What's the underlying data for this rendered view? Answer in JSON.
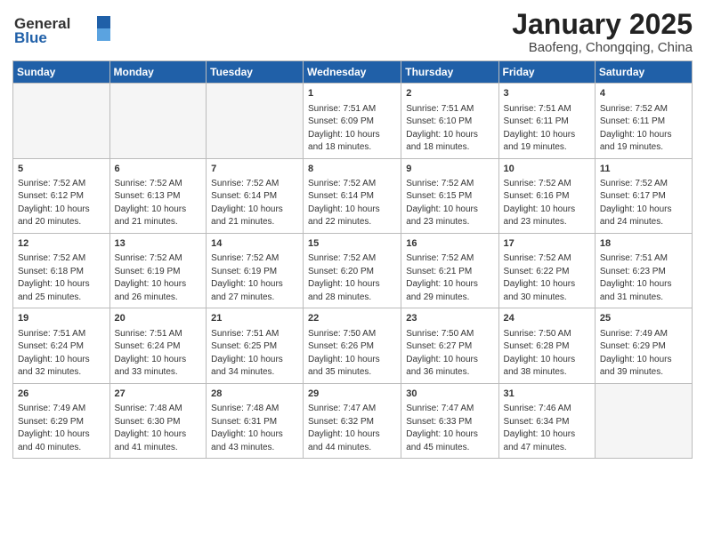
{
  "logo": {
    "general": "General",
    "blue": "Blue"
  },
  "header": {
    "month": "January 2025",
    "location": "Baofeng, Chongqing, China"
  },
  "weekdays": [
    "Sunday",
    "Monday",
    "Tuesday",
    "Wednesday",
    "Thursday",
    "Friday",
    "Saturday"
  ],
  "weeks": [
    [
      {
        "day": "",
        "info": ""
      },
      {
        "day": "",
        "info": ""
      },
      {
        "day": "",
        "info": ""
      },
      {
        "day": "1",
        "info": "Sunrise: 7:51 AM\nSunset: 6:09 PM\nDaylight: 10 hours\nand 18 minutes."
      },
      {
        "day": "2",
        "info": "Sunrise: 7:51 AM\nSunset: 6:10 PM\nDaylight: 10 hours\nand 18 minutes."
      },
      {
        "day": "3",
        "info": "Sunrise: 7:51 AM\nSunset: 6:11 PM\nDaylight: 10 hours\nand 19 minutes."
      },
      {
        "day": "4",
        "info": "Sunrise: 7:52 AM\nSunset: 6:11 PM\nDaylight: 10 hours\nand 19 minutes."
      }
    ],
    [
      {
        "day": "5",
        "info": "Sunrise: 7:52 AM\nSunset: 6:12 PM\nDaylight: 10 hours\nand 20 minutes."
      },
      {
        "day": "6",
        "info": "Sunrise: 7:52 AM\nSunset: 6:13 PM\nDaylight: 10 hours\nand 21 minutes."
      },
      {
        "day": "7",
        "info": "Sunrise: 7:52 AM\nSunset: 6:14 PM\nDaylight: 10 hours\nand 21 minutes."
      },
      {
        "day": "8",
        "info": "Sunrise: 7:52 AM\nSunset: 6:14 PM\nDaylight: 10 hours\nand 22 minutes."
      },
      {
        "day": "9",
        "info": "Sunrise: 7:52 AM\nSunset: 6:15 PM\nDaylight: 10 hours\nand 23 minutes."
      },
      {
        "day": "10",
        "info": "Sunrise: 7:52 AM\nSunset: 6:16 PM\nDaylight: 10 hours\nand 23 minutes."
      },
      {
        "day": "11",
        "info": "Sunrise: 7:52 AM\nSunset: 6:17 PM\nDaylight: 10 hours\nand 24 minutes."
      }
    ],
    [
      {
        "day": "12",
        "info": "Sunrise: 7:52 AM\nSunset: 6:18 PM\nDaylight: 10 hours\nand 25 minutes."
      },
      {
        "day": "13",
        "info": "Sunrise: 7:52 AM\nSunset: 6:19 PM\nDaylight: 10 hours\nand 26 minutes."
      },
      {
        "day": "14",
        "info": "Sunrise: 7:52 AM\nSunset: 6:19 PM\nDaylight: 10 hours\nand 27 minutes."
      },
      {
        "day": "15",
        "info": "Sunrise: 7:52 AM\nSunset: 6:20 PM\nDaylight: 10 hours\nand 28 minutes."
      },
      {
        "day": "16",
        "info": "Sunrise: 7:52 AM\nSunset: 6:21 PM\nDaylight: 10 hours\nand 29 minutes."
      },
      {
        "day": "17",
        "info": "Sunrise: 7:52 AM\nSunset: 6:22 PM\nDaylight: 10 hours\nand 30 minutes."
      },
      {
        "day": "18",
        "info": "Sunrise: 7:51 AM\nSunset: 6:23 PM\nDaylight: 10 hours\nand 31 minutes."
      }
    ],
    [
      {
        "day": "19",
        "info": "Sunrise: 7:51 AM\nSunset: 6:24 PM\nDaylight: 10 hours\nand 32 minutes."
      },
      {
        "day": "20",
        "info": "Sunrise: 7:51 AM\nSunset: 6:24 PM\nDaylight: 10 hours\nand 33 minutes."
      },
      {
        "day": "21",
        "info": "Sunrise: 7:51 AM\nSunset: 6:25 PM\nDaylight: 10 hours\nand 34 minutes."
      },
      {
        "day": "22",
        "info": "Sunrise: 7:50 AM\nSunset: 6:26 PM\nDaylight: 10 hours\nand 35 minutes."
      },
      {
        "day": "23",
        "info": "Sunrise: 7:50 AM\nSunset: 6:27 PM\nDaylight: 10 hours\nand 36 minutes."
      },
      {
        "day": "24",
        "info": "Sunrise: 7:50 AM\nSunset: 6:28 PM\nDaylight: 10 hours\nand 38 minutes."
      },
      {
        "day": "25",
        "info": "Sunrise: 7:49 AM\nSunset: 6:29 PM\nDaylight: 10 hours\nand 39 minutes."
      }
    ],
    [
      {
        "day": "26",
        "info": "Sunrise: 7:49 AM\nSunset: 6:29 PM\nDaylight: 10 hours\nand 40 minutes."
      },
      {
        "day": "27",
        "info": "Sunrise: 7:48 AM\nSunset: 6:30 PM\nDaylight: 10 hours\nand 41 minutes."
      },
      {
        "day": "28",
        "info": "Sunrise: 7:48 AM\nSunset: 6:31 PM\nDaylight: 10 hours\nand 43 minutes."
      },
      {
        "day": "29",
        "info": "Sunrise: 7:47 AM\nSunset: 6:32 PM\nDaylight: 10 hours\nand 44 minutes."
      },
      {
        "day": "30",
        "info": "Sunrise: 7:47 AM\nSunset: 6:33 PM\nDaylight: 10 hours\nand 45 minutes."
      },
      {
        "day": "31",
        "info": "Sunrise: 7:46 AM\nSunset: 6:34 PM\nDaylight: 10 hours\nand 47 minutes."
      },
      {
        "day": "",
        "info": ""
      }
    ]
  ]
}
